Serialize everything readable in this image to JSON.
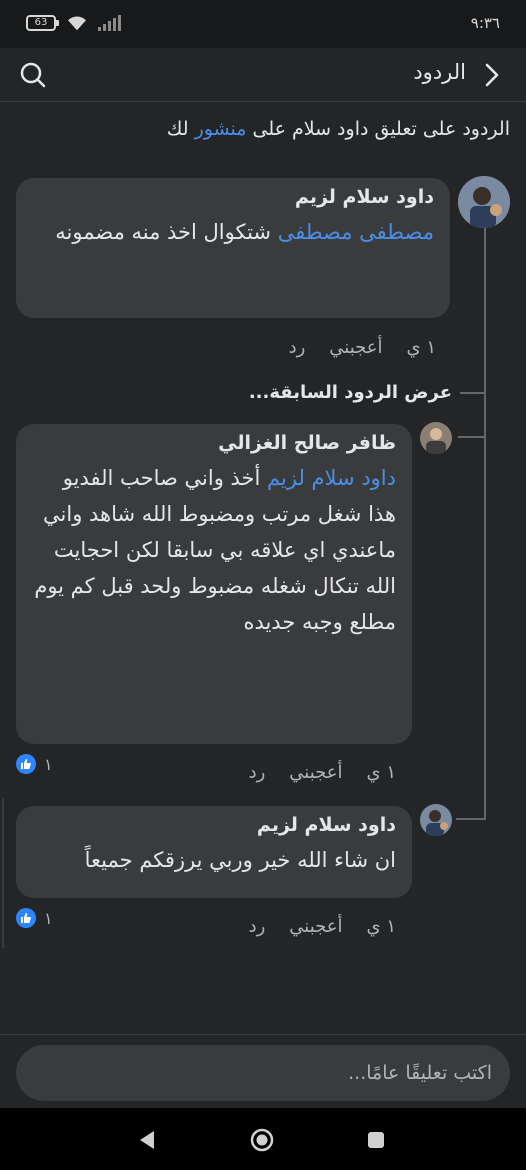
{
  "status_bar": {
    "battery": "63",
    "time": "٩:٣٦"
  },
  "header": {
    "title": "الردود"
  },
  "context": {
    "prefix": "الردود على تعليق داود سلام على ",
    "link": "منشور",
    "suffix": " لك"
  },
  "comments": [
    {
      "author": "داود سلام لزيم",
      "mention": "مصطفى مصطفى",
      "text": " شتكوال اخذ منه مضمونه",
      "time": "١ ي",
      "like_label": "أعجبني",
      "reply_label": "رد"
    },
    {
      "author": "ظافر صالح الغزالي",
      "mention": "داود سلام لزيم",
      "text": " أخذ واني صاحب الفديو هذا شغل مرتب ومضبوط الله شاهد واني ماعندي اي علاقه بي سابقا لكن احجايت الله تنكال شغله مضبوط ولحد قبل كم يوم مطلع وجبه جديده",
      "time": "١ ي",
      "like_label": "أعجبني",
      "reply_label": "رد",
      "reactions": "١"
    },
    {
      "author": "داود سلام لزيم",
      "text": "ان شاء الله خير وربي يرزقكم جميعاً",
      "time": "١ ي",
      "like_label": "أعجبني",
      "reply_label": "رد",
      "reactions": "١"
    }
  ],
  "previous_replies": "عرض الردود السابقة...",
  "composer": {
    "placeholder": "اكتب تعليقًا عامًا..."
  },
  "nav": {
    "icons": [
      "back-triangle-icon",
      "home-circle-icon",
      "recents-square-icon"
    ]
  },
  "colors": {
    "background": "#242526",
    "bubble": "#3a3b3c",
    "link": "#4a8fe7",
    "like": "#2d86ff"
  }
}
